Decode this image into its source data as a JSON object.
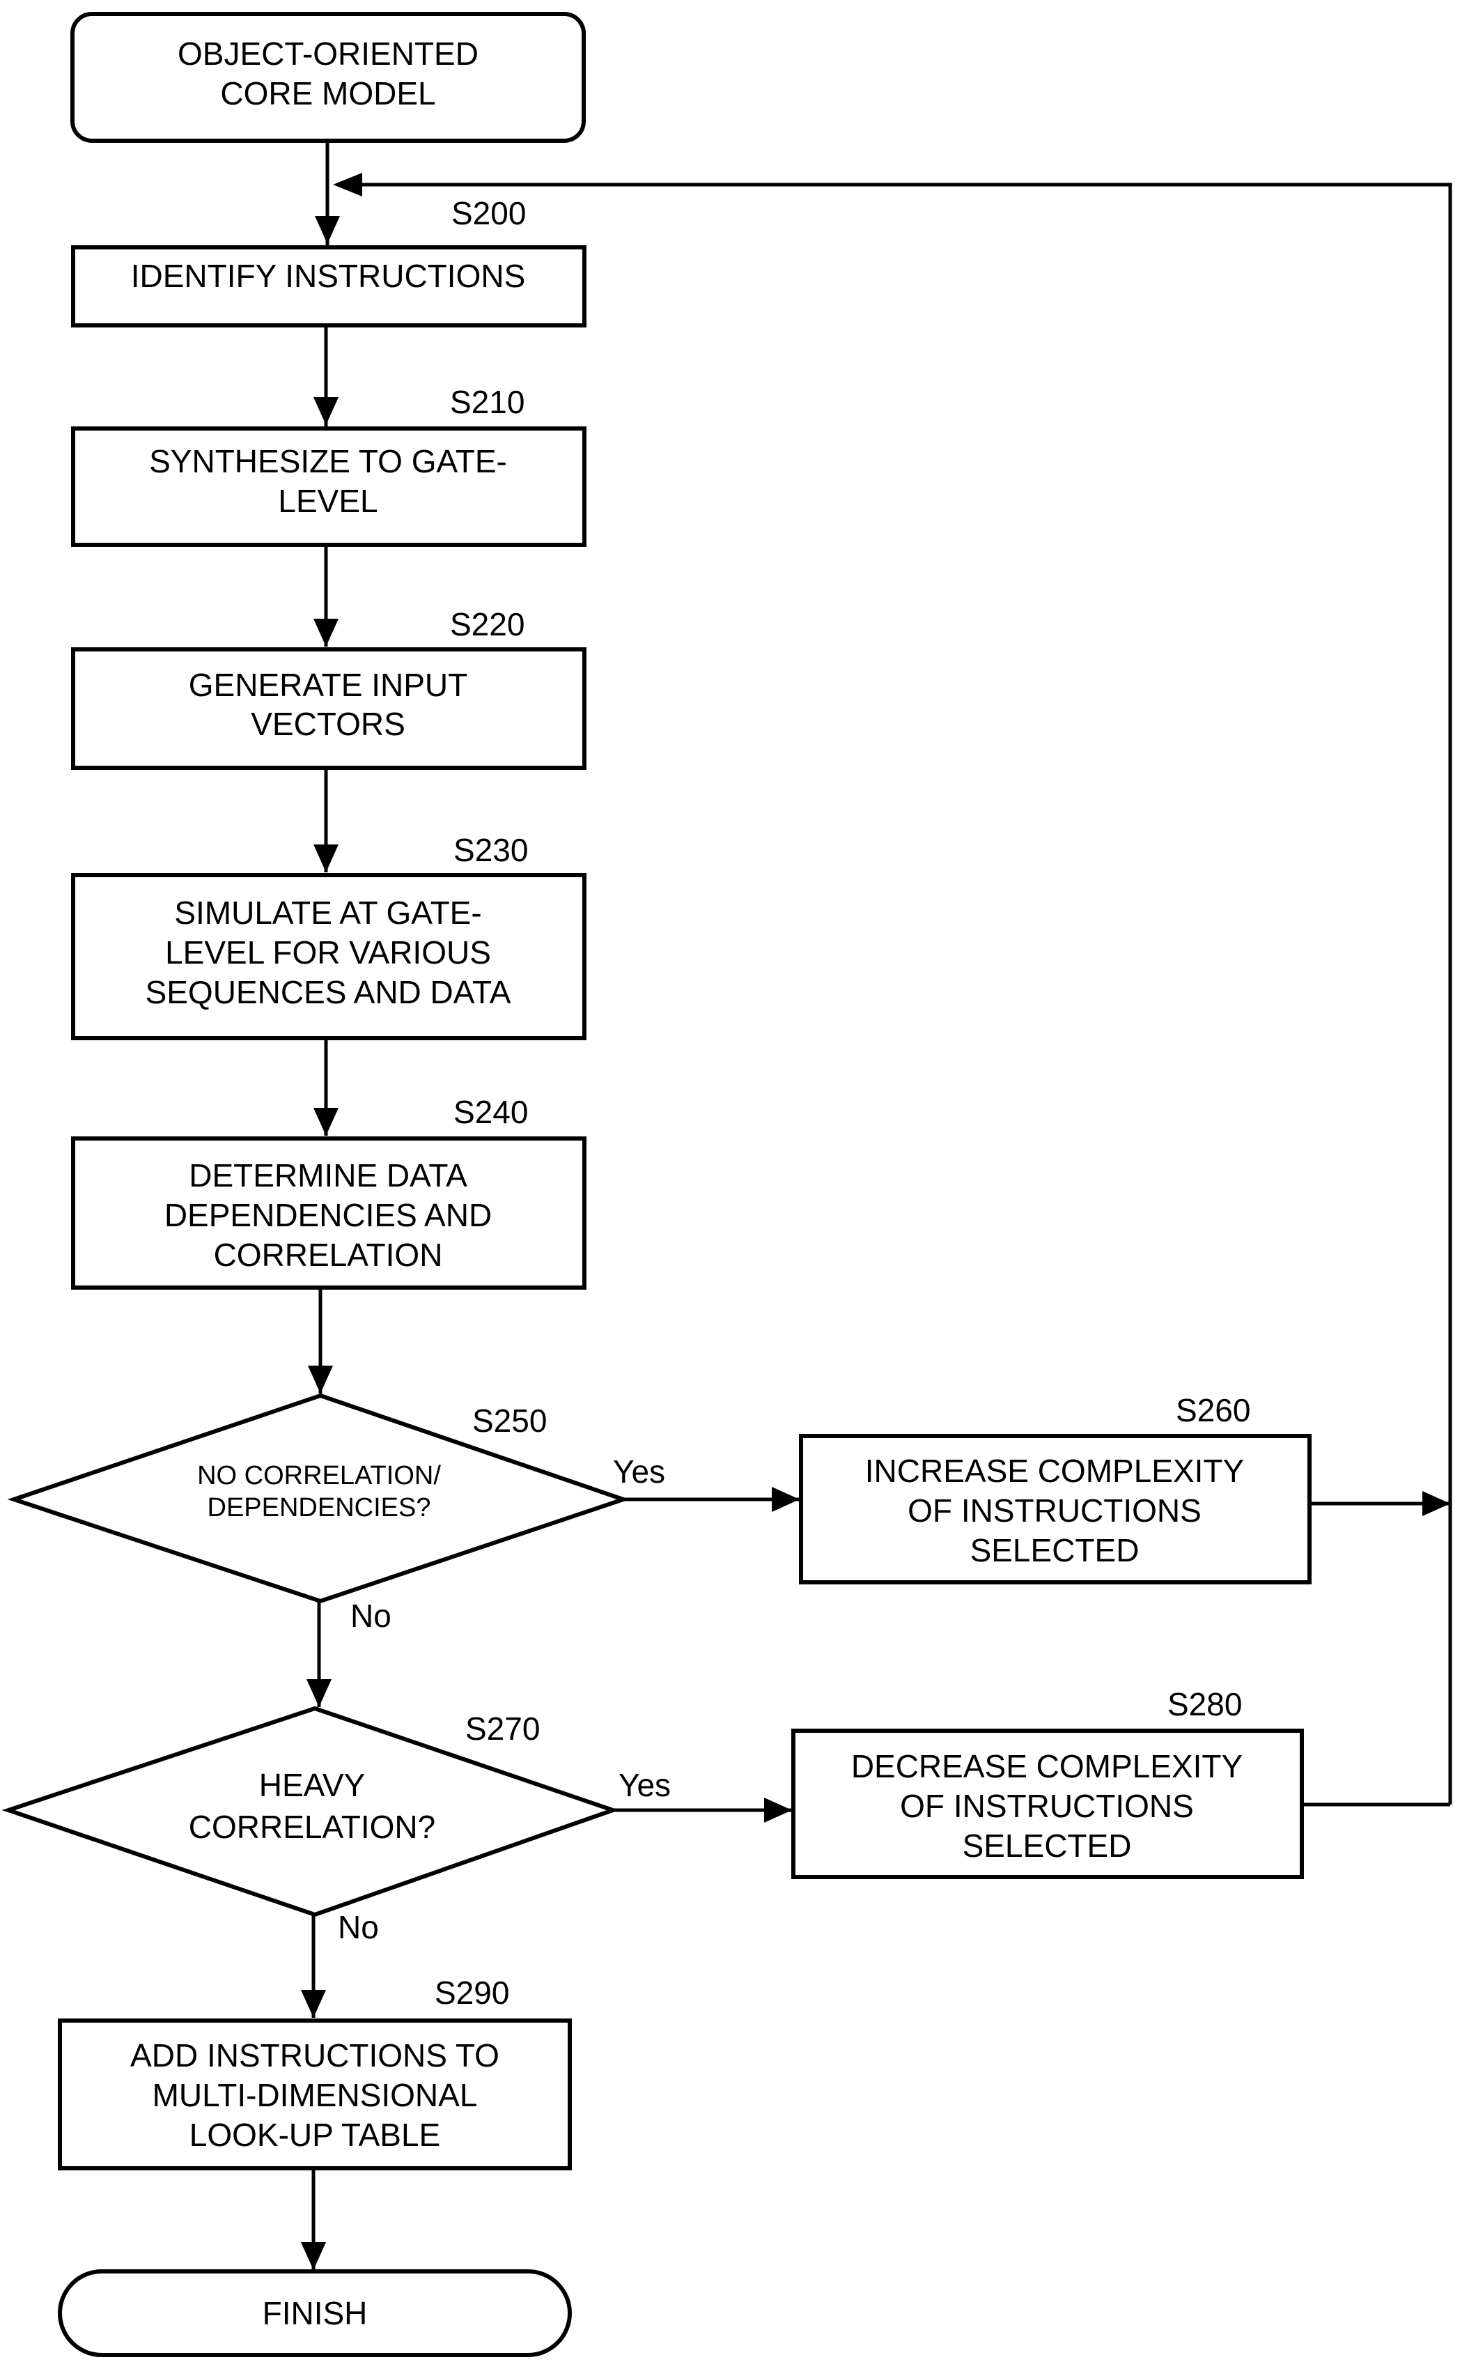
{
  "start": {
    "lines": [
      "OBJECT-ORIENTED",
      "CORE MODEL"
    ]
  },
  "steps": [
    {
      "id": "S200",
      "lines": [
        "IDENTIFY INSTRUCTIONS"
      ]
    },
    {
      "id": "S210",
      "lines": [
        "SYNTHESIZE TO GATE-",
        "LEVEL"
      ]
    },
    {
      "id": "S220",
      "lines": [
        "GENERATE INPUT",
        "VECTORS"
      ]
    },
    {
      "id": "S230",
      "lines": [
        "SIMULATE AT GATE-",
        "LEVEL FOR VARIOUS",
        "SEQUENCES AND DATA"
      ]
    },
    {
      "id": "S240",
      "lines": [
        "DETERMINE DATA",
        "DEPENDENCIES AND",
        "CORRELATION"
      ]
    }
  ],
  "decisions": [
    {
      "id": "S250",
      "lines": [
        "NO CORRELATION/",
        "DEPENDENCIES?"
      ],
      "yes": "Yes",
      "no": "No"
    },
    {
      "id": "S270",
      "lines": [
        "HEAVY",
        "CORRELATION?"
      ],
      "yes": "Yes",
      "no": "No"
    }
  ],
  "side_steps": [
    {
      "id": "S260",
      "lines": [
        "INCREASE COMPLEXITY",
        "OF INSTRUCTIONS",
        "SELECTED"
      ]
    },
    {
      "id": "S280",
      "lines": [
        "DECREASE COMPLEXITY",
        "OF INSTRUCTIONS",
        "SELECTED"
      ]
    }
  ],
  "final_step": {
    "id": "S290",
    "lines": [
      "ADD INSTRUCTIONS TO",
      "MULTI-DIMENSIONAL",
      "LOOK-UP TABLE"
    ]
  },
  "end": {
    "label": "FINISH"
  }
}
